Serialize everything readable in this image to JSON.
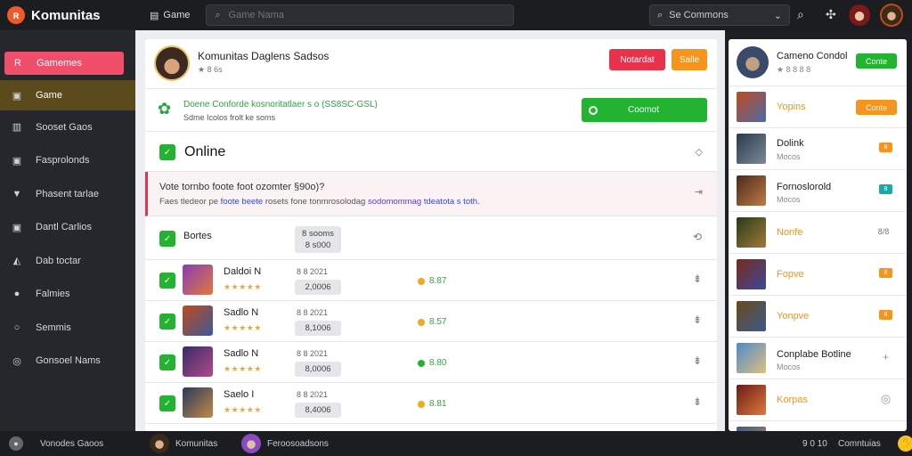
{
  "app": {
    "name": "Komunitas",
    "logo_glyph": "ʀ"
  },
  "topbar": {
    "games_label": "Game",
    "games_icon": "gamepad-icon",
    "search_placeholder": "Game Nama",
    "search_right_label": "Se Commons",
    "icons": [
      "search-icon",
      "puzzle-icon"
    ]
  },
  "sidebar": {
    "items": [
      {
        "label": "Gamemes",
        "icon": "R",
        "kind": "active"
      },
      {
        "label": "Game",
        "icon": "▣",
        "kind": "game"
      },
      {
        "label": "Sooset Gaos",
        "icon": "▥",
        "kind": "normal"
      },
      {
        "label": "Fasprolonds",
        "icon": "▣",
        "kind": "normal"
      },
      {
        "label": "Phasent tarlae",
        "icon": "▼",
        "kind": "normal"
      },
      {
        "label": "Dantl Carlios",
        "icon": "▣",
        "kind": "normal"
      },
      {
        "label": "Dab toctar",
        "icon": "◭",
        "kind": "normal"
      },
      {
        "label": "Falmies",
        "icon": "●",
        "kind": "normal"
      },
      {
        "label": "Semmis",
        "icon": "○",
        "kind": "normal"
      },
      {
        "label": "Gonsoel Nams",
        "icon": "◎",
        "kind": "normal"
      }
    ]
  },
  "profile": {
    "name": "Komunitas Daglens Sadsos",
    "sub": "★ 8 6s",
    "btn_primary": "Notardat",
    "btn_secondary": "Salle"
  },
  "connect": {
    "line1": "Doene Conforde kosnoritatlaer s o (SS8SC-GSL)",
    "line2": "Sdme Icolos frolt ke soms",
    "button": "Coomot"
  },
  "online": {
    "title": "Online"
  },
  "notice": {
    "line1": "Vote tornbo foote foot ozomter §90o)?",
    "line2_a": "Faes tledeor pe ",
    "line2_link1": "foote beete",
    "line2_b": " rosets fone tonmrosolodag ",
    "line2_link2": "sodomommag ",
    "line2_link3": "tdeatota s toth."
  },
  "header_row": {
    "label": "Bortes",
    "pill": "8 sooms\n8 s000"
  },
  "rows": [
    {
      "name": "Daldoi N",
      "stars": "★★★★★",
      "date": "8 8 2021",
      "pill": "2,0006",
      "status": "8.87",
      "status_color": "#22b331",
      "thumb": [
        "#8a3ab9",
        "#e07a3a"
      ]
    },
    {
      "name": "Sadlo N",
      "stars": "★★★★★",
      "date": "8 8 2021",
      "pill": "8,1006",
      "status": "8.57",
      "status_color": "#f4a81c",
      "thumb": [
        "#c04a1a",
        "#3a5a9a"
      ]
    },
    {
      "name": "Sadlo N",
      "stars": "★★★★★",
      "date": "8 8 2021",
      "pill": "8,0006",
      "status": "8.80",
      "status_color": "#22b331",
      "thumb": [
        "#3a2a6a",
        "#b04a8a"
      ]
    },
    {
      "name": "Saelo I",
      "stars": "★★★★★",
      "date": "8 8 2021",
      "pill": "8,4006",
      "status": "8.81",
      "status_color": "#f4a81c",
      "thumb": [
        "#2a3a5a",
        "#c08a4a"
      ]
    }
  ],
  "right_panel": {
    "items": [
      {
        "name": "Cameno Condol",
        "sub": "★ 8 8 8 8",
        "tag": "Conte",
        "tag_color": "#22b331",
        "name_color": "#222",
        "thumb": [
          "#3a4a6a",
          "#b07a5a"
        ]
      },
      {
        "name": "Yopins",
        "sub": "",
        "tag": "Conte",
        "tag_color": "#f7941d",
        "name_color": "#f7941d",
        "thumb": [
          "#c04a1a",
          "#4a6aaa"
        ]
      },
      {
        "name": "Dolink",
        "sub": "Mocos",
        "tag": "8",
        "tag_color": "#f7941d",
        "name_color": "#222",
        "thumb": [
          "#2a3a4a",
          "#7a8a9a"
        ]
      },
      {
        "name": "Fornoslorold",
        "sub": "Mocos",
        "tag": "8",
        "tag_color": "#1aa9a9",
        "name_color": "#222",
        "thumb": [
          "#4a2a1a",
          "#c07a4a"
        ]
      },
      {
        "name": "Nonfe",
        "sub": "",
        "tag": "8/8",
        "tag_color": "#999",
        "name_color": "#f7941d",
        "thumb": [
          "#2a3a1a",
          "#a07a3a"
        ]
      },
      {
        "name": "Fopve",
        "sub": "",
        "tag": "8",
        "tag_color": "#f7941d",
        "name_color": "#f7941d",
        "thumb": [
          "#7a2a1a",
          "#3a4a9a"
        ]
      },
      {
        "name": "Yonpve",
        "sub": "",
        "tag": "8",
        "tag_color": "#f7941d",
        "name_color": "#f7941d",
        "thumb": [
          "#6a4a1a",
          "#3a5a8a"
        ]
      },
      {
        "name": "Conplabe Botline",
        "sub": "Mocos",
        "tag": "+",
        "tag_color": "#fff",
        "name_color": "#222",
        "thumb": [
          "#4a8aca",
          "#e0c080"
        ]
      },
      {
        "name": "Korpas",
        "sub": "",
        "tag": "◎",
        "tag_color": "#fff",
        "name_color": "#f7941d",
        "thumb": [
          "#6a1a1a",
          "#e07a3a"
        ]
      }
    ]
  },
  "footer": {
    "status": "Vonodes Gaoos",
    "user1": "Komunitas",
    "user2": "Feroosoadsons",
    "count": "9 0 10",
    "right_label": "Comntuias"
  }
}
